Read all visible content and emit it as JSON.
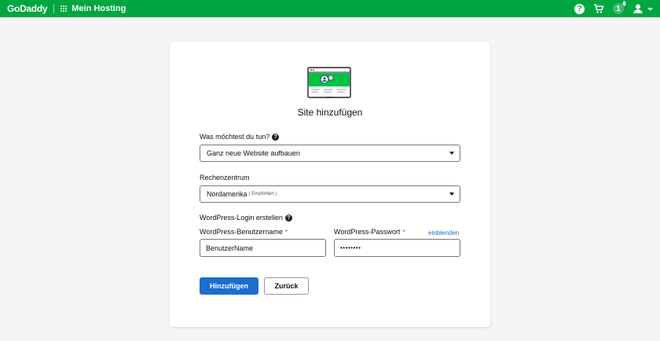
{
  "header": {
    "brand": "GoDaddy",
    "nav_label": "Mein Hosting",
    "help_glyph": "?",
    "notification_count": "1",
    "colors": {
      "bar": "#00a63f"
    },
    "icons": [
      "apps-grid-icon",
      "help-icon",
      "cart-icon",
      "bell-icon",
      "user-icon",
      "chevron-down-icon"
    ]
  },
  "card": {
    "title": "Site hinzufügen",
    "illustration_icon": "website-illustration-icon"
  },
  "form": {
    "goal": {
      "label": "Was möchtest du tun?",
      "value": "Ganz neue Website aufbauen"
    },
    "datacenter": {
      "label": "Rechenzentrum",
      "value": "Nordamerika",
      "hint": "( Empfohlen )"
    },
    "wp_login": {
      "label": "WordPress-Login erstellen",
      "username_label": "WordPress-Benutzername",
      "username_value": "BenutzerName",
      "password_label": "WordPress-Passwort",
      "password_value": "••••••••",
      "required_mark": "*",
      "show_link": "einblenden"
    },
    "actions": {
      "submit": "Hinzufügen",
      "back": "Zurück"
    },
    "colors": {
      "primary": "#1b6dd0",
      "link": "#1a6fc1",
      "required": "#d9252a"
    }
  }
}
